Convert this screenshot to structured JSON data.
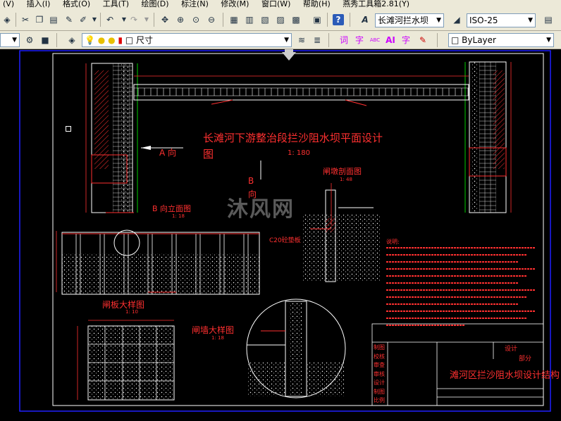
{
  "menu": [
    "(V)",
    "插入(I)",
    "格式(O)",
    "工具(T)",
    "绘图(D)",
    "标注(N)",
    "修改(M)",
    "窗口(W)",
    "帮助(H)",
    "燕秀工具箱2.81(Y)"
  ],
  "toolbar1": {
    "text_style_value": "长滩河拦水坝",
    "dim_style_value": "ISO-25"
  },
  "toolbar2": {
    "layer_value": "尺寸",
    "color_value": "ByLayer",
    "tool_labels": [
      "词",
      "字",
      "ABC",
      "AI",
      "字"
    ]
  },
  "drawing": {
    "main_title": "长滩河下游整治段拦沙阻水坝平面设计",
    "main_title_cont": "图",
    "main_scale": "1: 180",
    "dir_a": "A 向",
    "dir_b_1": "B",
    "dir_b_2": "向",
    "b_elev_title": "B 向立面图",
    "b_elev_scale": "1: 18",
    "gate_section_title": "闸墩剖面图",
    "gate_section_scale": "1: 48",
    "c20_label": "C20砼垫板",
    "gate_plate_title": "闸板大样图",
    "gate_plate_scale": "1: 10",
    "gate_pier_title": "闸墙大样图",
    "gate_pier_scale": "1: 18",
    "notes_title": "说明:",
    "title_block": {
      "project": "滩河区拦沙阻水坝设计结构",
      "rows": [
        "制图",
        "校核",
        "审查",
        "审核",
        "设计",
        "制图",
        "比例"
      ],
      "right_labels": [
        "设计",
        "部分"
      ]
    }
  },
  "watermark": "沐风网"
}
